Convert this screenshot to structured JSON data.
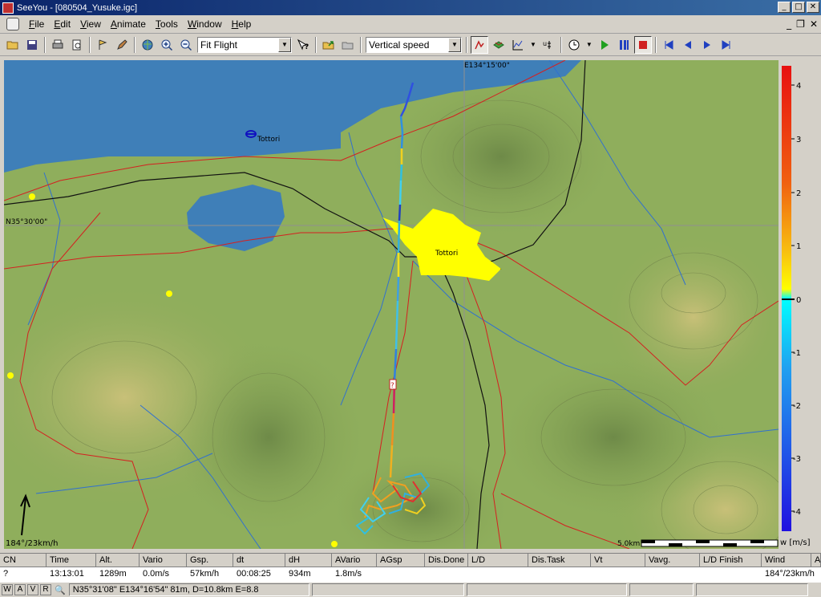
{
  "window": {
    "title": "SeeYou - [080504_Yusuke.igc]"
  },
  "menu": [
    "File",
    "Edit",
    "View",
    "Animate",
    "Tools",
    "Window",
    "Help"
  ],
  "toolbar": {
    "zoom_mode": "Fit Flight",
    "color_mode": "Vertical speed"
  },
  "map": {
    "labels": {
      "longitude": "E134°15'00\"",
      "latitude": "N35°30'00\"",
      "town_tottori_coast": "Tottori",
      "town_tottori_city": "Tottori",
      "wind": "184°/23km/h",
      "scale": "5.0km",
      "marker": "?"
    },
    "colors": {
      "sea": "#3f7fb8",
      "airspace_red": "#d42020",
      "city": "#ffff00",
      "road": "#111111",
      "river": "#3070d0"
    }
  },
  "legend": {
    "ticks": [
      "4",
      "3",
      "2",
      "1",
      "0",
      "-1",
      "-2",
      "-3",
      "-4"
    ],
    "unit": "w [m/s]"
  },
  "grid": {
    "columns": [
      "CN",
      "Time",
      "Alt.",
      "Vario",
      "Gsp.",
      "dt",
      "dH",
      "AVario",
      "AGsp",
      "Dis.Done",
      "L/D",
      "Dis.Task",
      "Vt",
      "Vavg.",
      "L/D Finish",
      "Wind",
      "A"
    ],
    "row": [
      "?",
      "13:13:01",
      "1289m",
      "0.0m/s",
      "57km/h",
      "00:08:25",
      "934m",
      "1.8m/s",
      "",
      "",
      "",
      "",
      "",
      "",
      "",
      "184°/23km/h",
      ""
    ]
  },
  "status": {
    "buttons": [
      "W",
      "A",
      "V",
      "R"
    ],
    "text": "N35°31'08\" E134°16'54\" 81m, D=10.8km E=8.8"
  }
}
